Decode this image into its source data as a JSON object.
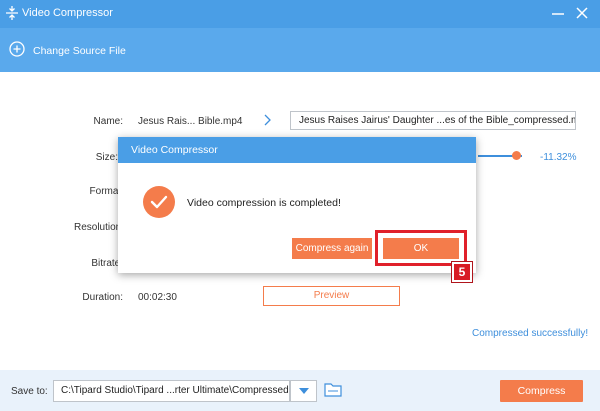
{
  "window": {
    "title": "Video Compressor"
  },
  "source": {
    "change_label": "Change Source File"
  },
  "form": {
    "name_label": "Name:",
    "name_value": "Jesus Rais... Bible.mp4",
    "output_name": "Jesus Raises Jairus' Daughter ...es of the Bible_compressed.mp4",
    "size_label": "Size:",
    "size_percent": "-11.32%",
    "format_label": "Format:",
    "resolution_label": "Resolution:",
    "bitrate_label": "Bitrate:",
    "duration_label": "Duration:",
    "duration_value": "00:02:30",
    "preview_label": "Preview",
    "success_text": "Compressed successfully!"
  },
  "bottom": {
    "save_to_label": "Save to:",
    "path": "C:\\Tipard Studio\\Tipard ...rter Ultimate\\Compressed",
    "compress_label": "Compress"
  },
  "dialog": {
    "title": "Video Compressor",
    "message": "Video compression is completed!",
    "compress_again_label": "Compress again",
    "ok_label": "OK"
  },
  "annotation": {
    "step_number": "5"
  },
  "colors": {
    "titlebar": "#4a9ee6",
    "accent_orange": "#f47c4b",
    "accent_blue": "#3e8fdc",
    "highlight_red": "#e0202a"
  }
}
